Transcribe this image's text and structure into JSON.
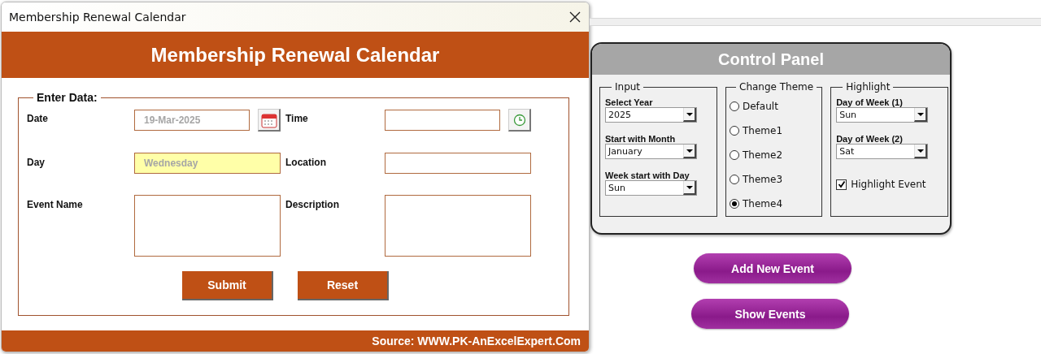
{
  "dialog": {
    "title": "Membership Renewal Calendar",
    "header": "Membership Renewal Calendar",
    "form": {
      "legend": "Enter Data:",
      "fields": [
        {
          "label": "Date",
          "kind": "date",
          "placeholder": "19-Mar-2025"
        },
        {
          "label": "Time",
          "kind": "time"
        },
        {
          "label": "Day",
          "kind": "highlighted",
          "placeholder": "Wednesday"
        },
        {
          "label": "Location",
          "kind": "text"
        },
        {
          "label": "Event Name",
          "kind": "memo"
        },
        {
          "label": "Description",
          "kind": "memo"
        }
      ],
      "buttons": [
        "Submit",
        "Reset"
      ]
    },
    "footer": "Source: WWW.PK-AnExcelExpert.Com"
  },
  "control_panel": {
    "title": "Control Panel",
    "groups": [
      {
        "legend": "Input",
        "items": [
          {
            "kind": "combo",
            "label": "Select Year",
            "value": "2025"
          },
          {
            "kind": "combo",
            "label": "Start with Month",
            "value": "January"
          },
          {
            "kind": "combo",
            "label": "Week start with Day",
            "value": "Sun"
          }
        ]
      },
      {
        "legend": "Change Theme",
        "items": [
          {
            "kind": "radio",
            "label": "Default",
            "selected": false
          },
          {
            "kind": "radio",
            "label": "Theme1",
            "selected": false
          },
          {
            "kind": "radio",
            "label": "Theme2",
            "selected": false
          },
          {
            "kind": "radio",
            "label": "Theme3",
            "selected": false
          },
          {
            "kind": "radio",
            "label": "Theme4",
            "selected": true
          }
        ]
      },
      {
        "legend": "Highlight",
        "items": [
          {
            "kind": "combo",
            "label": "Day of Week (1)",
            "value": "Sun"
          },
          {
            "kind": "combo",
            "label": "Day of Week (2)",
            "value": "Sat"
          },
          {
            "kind": "checkbox",
            "label": "Highlight Event",
            "checked": true
          }
        ]
      }
    ]
  },
  "actions": [
    "Add New Event",
    "Show Events"
  ]
}
